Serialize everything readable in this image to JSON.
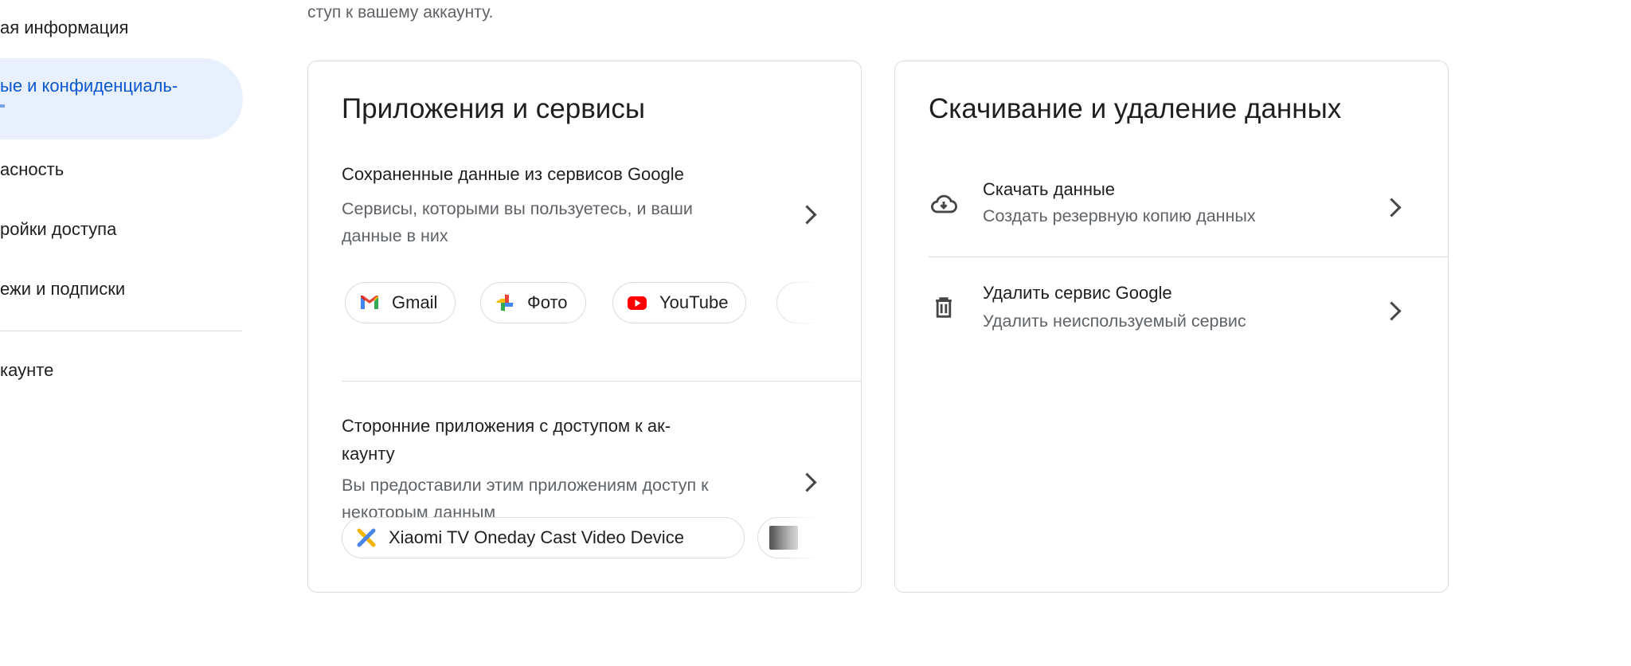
{
  "sidebar": {
    "items": [
      {
        "label": "ая информация"
      },
      {
        "label_line1": "ые и конфиденциаль-",
        "label_line2": "",
        "selected": true
      },
      {
        "label": "асность"
      },
      {
        "label": "ройки доступа"
      },
      {
        "label": "ежи и подписки"
      },
      {
        "label": "каунте"
      }
    ],
    "selected_color": "#0b57d0",
    "selected_bg": "#e8f0fe"
  },
  "intro_text": "ступ к вашему аккаунту.",
  "apps_card": {
    "title": "Приложения и сервисы",
    "saved_data": {
      "title": "Сохраненные данные из сервисов Google",
      "description_line1": "Сервисы, которыми вы пользуетесь, и ваши",
      "description_line2": "данные в них",
      "chips": [
        {
          "label": "Gmail",
          "icon": "gmail-icon"
        },
        {
          "label": "Фото",
          "icon": "google-photos-icon"
        },
        {
          "label": "YouTube",
          "icon": "youtube-icon"
        },
        {
          "label": "",
          "icon": "partial-app-icon"
        }
      ]
    },
    "third_party": {
      "title_line1": "Сторонние приложения с доступом к ак-",
      "title_line2": "каунту",
      "description_line1": "Вы предоставили этим приложениям доступ к",
      "description_line2": "некоторым данным",
      "chips": [
        {
          "label": "Xiaomi TV Oneday Cast Video Device",
          "icon": "xiaomi-cast-icon"
        },
        {
          "label": "",
          "icon": "partial-app-thumbnail-icon"
        }
      ]
    }
  },
  "data_card": {
    "title": "Скачивание и удаление данных",
    "items": [
      {
        "title": "Скачать данные",
        "description": "Создать резервную копию данных",
        "icon": "cloud-download-icon"
      },
      {
        "title": "Удалить сервис Google",
        "description": "Удалить неиспользуемый сервис",
        "icon": "trash-icon"
      }
    ]
  }
}
